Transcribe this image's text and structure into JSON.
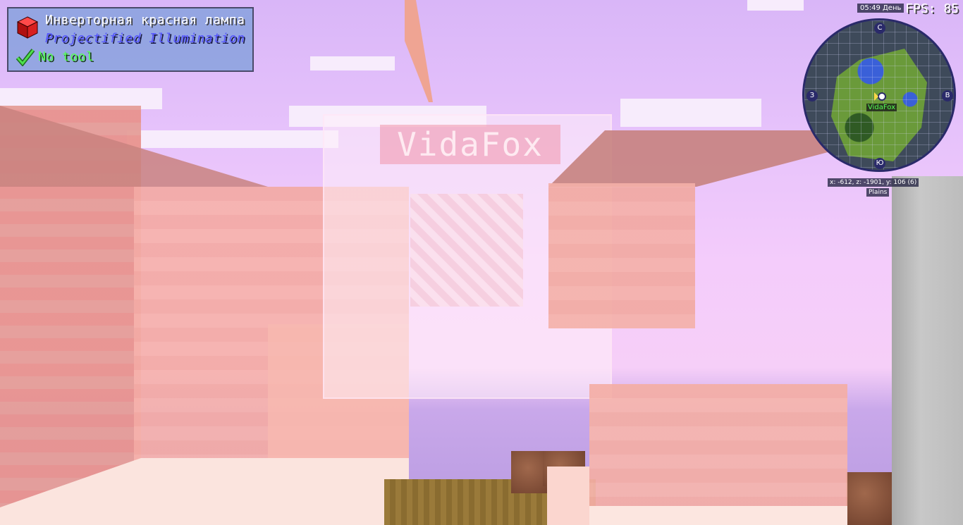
{
  "hud": {
    "block_name": "Инверторная красная лампа",
    "mod_name": "Projectified Illumination",
    "tool_text": "No tool",
    "block_icon": "redstone-lamp-icon",
    "tool_icon": "checkmark-icon"
  },
  "fps": "FPS: 85",
  "minimap": {
    "time": "05:49 День",
    "compass": {
      "north": "С",
      "south": "Ю",
      "west": "З",
      "east": "В"
    },
    "player_name": "VidaFox",
    "coords": "x: -612, z: -1901, y: 106 (6)",
    "biome": "Plains"
  },
  "world": {
    "nametag": "VidaFox"
  },
  "colors": {
    "name_text": "#ffffff",
    "mod_text": "#5555ff",
    "tool_text": "#55ff55",
    "player_label": "#55ff55",
    "hud_panel": "#82a0dc"
  }
}
